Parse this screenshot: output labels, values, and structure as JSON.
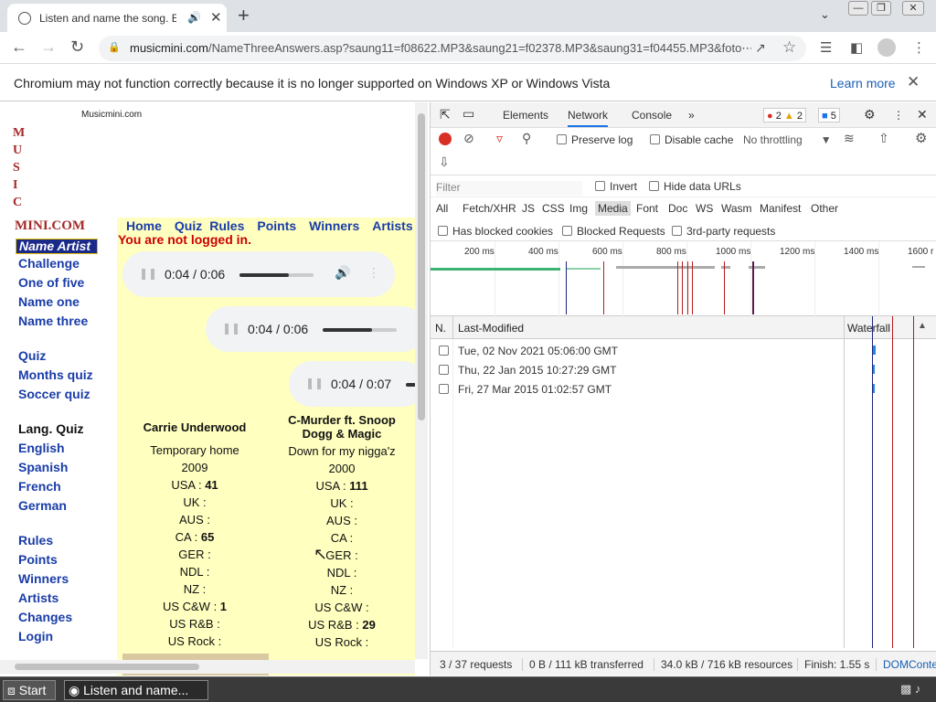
{
  "browser": {
    "tab_title": "Listen and name the song. E",
    "url_domain": "musicmini.com",
    "url_path": "/NameThreeAnswers.asp?saung11=f08622.MP3&saung21=f02378.MP3&saung31=f04455.MP3&foto⋯",
    "infobar_message": "Chromium may not function correctly because it is no longer supported on Windows XP or Windows Vista",
    "infobar_link": "Learn more"
  },
  "site": {
    "name": "Musicmini.com",
    "logo_letters": [
      "M",
      "U",
      "S",
      "I",
      "C"
    ],
    "logo_mini": "MINI.COM",
    "top_nav": [
      "Home",
      "Quiz",
      "Rules",
      "Points",
      "Winners",
      "Artists"
    ],
    "not_logged_in": "You are not logged in.",
    "sidebar_active": "Name Artist",
    "sidebar_group1": [
      "Challenge",
      "One of five",
      "Name one",
      "Name three"
    ],
    "sidebar_group2": [
      "Quiz",
      "Months quiz",
      "Soccer quiz"
    ],
    "sidebar_lang_header": "Lang. Quiz",
    "sidebar_group3": [
      "English",
      "Spanish",
      "French",
      "German"
    ],
    "sidebar_group4": [
      "Rules",
      "Points",
      "Winners",
      "Artists",
      "Changes",
      "Login"
    ]
  },
  "players": [
    {
      "time": "0:04 / 0:06",
      "progress": 0.67
    },
    {
      "time": "0:04 / 0:06",
      "progress": 0.67
    },
    {
      "time": "0:04 / 0:07",
      "progress": 0.57
    }
  ],
  "songs": [
    {
      "artist": "Carrie Underwood",
      "title": "Temporary home",
      "year": "2009",
      "charts": [
        [
          "USA",
          "41"
        ],
        [
          "UK",
          ""
        ],
        [
          "AUS",
          ""
        ],
        [
          "CA",
          "65"
        ],
        [
          "GER",
          ""
        ],
        [
          "NDL",
          ""
        ],
        [
          "NZ",
          ""
        ],
        [
          "US C&W",
          "1"
        ],
        [
          "US R&B",
          ""
        ],
        [
          "US Rock",
          ""
        ]
      ]
    },
    {
      "artist": "C-Murder ft. Snoop Dogg & Magic",
      "title": "Down for my nigga'z",
      "year": "2000",
      "charts": [
        [
          "USA",
          "111"
        ],
        [
          "UK",
          ""
        ],
        [
          "AUS",
          ""
        ],
        [
          "CA",
          ""
        ],
        [
          "GER",
          ""
        ],
        [
          "NDL",
          ""
        ],
        [
          "NZ",
          ""
        ],
        [
          "US C&W",
          ""
        ],
        [
          "US R&B",
          "29"
        ],
        [
          "US Rock",
          ""
        ]
      ]
    }
  ],
  "devtools": {
    "tabs": [
      "Elements",
      "Network",
      "Console"
    ],
    "active_tab": "Network",
    "errors": "2",
    "warnings": "2",
    "messages": "5",
    "preserve_log": "Preserve log",
    "disable_cache": "Disable cache",
    "throttling": "No throttling",
    "filter_placeholder": "Filter",
    "invert": "Invert",
    "hide_data_urls": "Hide data URLs",
    "types": [
      "All",
      "Fetch/XHR",
      "JS",
      "CSS",
      "Img",
      "Media",
      "Font",
      "Doc",
      "WS",
      "Wasm",
      "Manifest",
      "Other"
    ],
    "active_type": "Media",
    "has_blocked_cookies": "Has blocked cookies",
    "blocked_requests": "Blocked Requests",
    "third_party": "3rd-party requests",
    "timeline_ticks": [
      "200 ms",
      "400 ms",
      "600 ms",
      "800 ms",
      "1000 ms",
      "1200 ms",
      "1400 ms",
      "1600 r"
    ],
    "col_n": "N.",
    "col_last_modified": "Last-Modified",
    "col_waterfall": "Waterfall",
    "rows": [
      "Tue, 02 Nov 2021 05:06:00 GMT",
      "Thu, 22 Jan 2015 10:27:29 GMT",
      "Fri, 27 Mar 2015 01:02:57 GMT"
    ],
    "status_requests": "3 / 37 requests",
    "status_transferred": "0 B / 111 kB transferred",
    "status_resources": "34.0 kB / 716 kB resources",
    "status_finish": "Finish: 1.55 s",
    "status_dom": "DOMConte"
  },
  "taskbar": {
    "start": "Start",
    "task": "Listen and name..."
  },
  "colors": {
    "content_bg": "#ffffc0",
    "link": "#1a3da8",
    "logo": "#a52a2a",
    "not_logged": "#cc0000"
  }
}
